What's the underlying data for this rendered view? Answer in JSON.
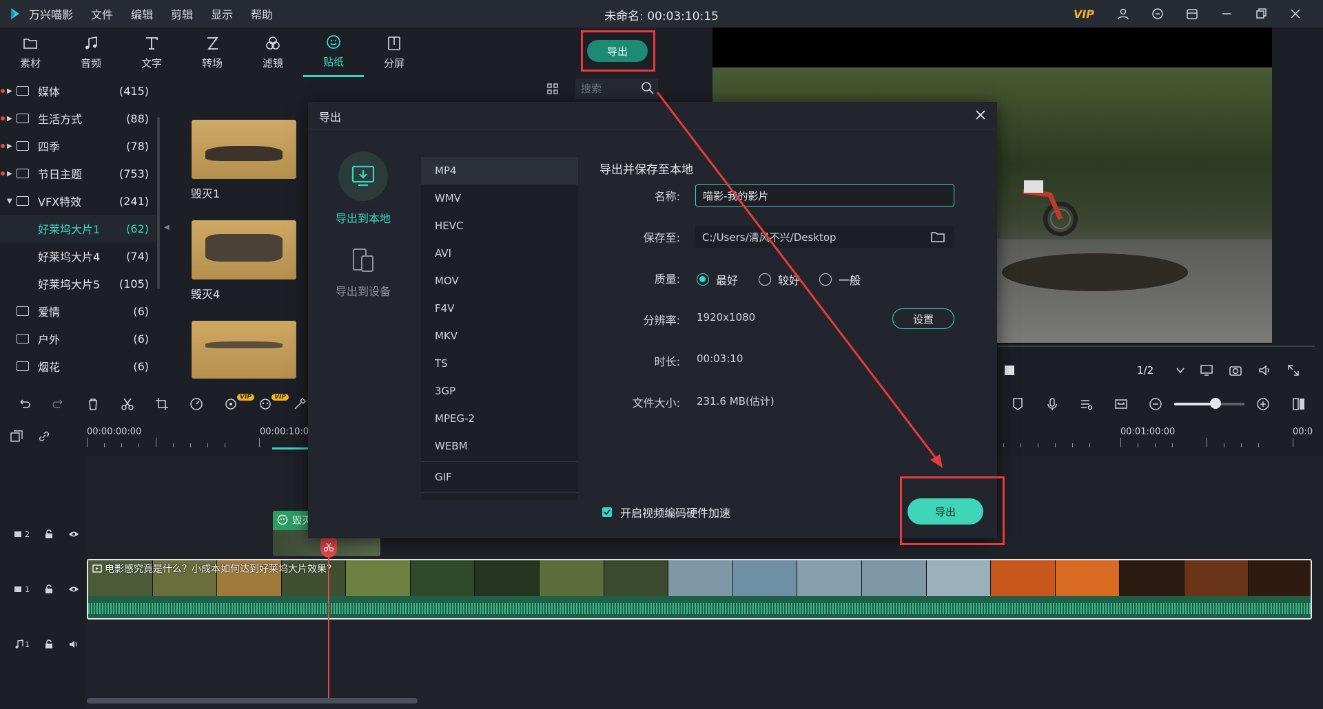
{
  "app": {
    "name": "万兴喵影",
    "window_title": "未命名: 00:03:10:15",
    "vip_label": "VIP"
  },
  "menu": [
    "文件",
    "编辑",
    "剪辑",
    "显示",
    "帮助"
  ],
  "toolbar": {
    "tabs": [
      "素材",
      "音频",
      "文字",
      "转场",
      "滤镜",
      "贴纸",
      "分屏"
    ],
    "active_tab": "贴纸",
    "export_label": "导出"
  },
  "categories": [
    {
      "name": "媒体",
      "count": "(415)",
      "dot": true,
      "arrow": "▶"
    },
    {
      "name": "生活方式",
      "count": "(88)",
      "dot": true,
      "arrow": "▶"
    },
    {
      "name": "四季",
      "count": "(78)",
      "dot": true,
      "arrow": "▶"
    },
    {
      "name": "节日主题",
      "count": "(753)",
      "dot": true,
      "arrow": "▶"
    },
    {
      "name": "VFX特效",
      "count": "(241)",
      "dot": false,
      "arrow": "▼"
    },
    {
      "name": "好莱坞大片1",
      "count": "(62)",
      "sub": true,
      "selected": true
    },
    {
      "name": "好莱坞大片4",
      "count": "(74)",
      "sub": true
    },
    {
      "name": "好莱坞大片5",
      "count": "(105)",
      "sub": true
    },
    {
      "name": "爱情",
      "count": "(6)"
    },
    {
      "name": "户外",
      "count": "(6)"
    },
    {
      "name": "烟花",
      "count": "(6)"
    }
  ],
  "search": {
    "placeholder": "搜索"
  },
  "stickers": [
    {
      "label": "毁灭1"
    },
    {
      "label": "毁灭4"
    }
  ],
  "preview": {
    "ratio": "1/2"
  },
  "ruler": {
    "t0": "00:00:00:00",
    "t1": "00:00:10:00",
    "t2": "00:01:00:00",
    "t3": "00:0"
  },
  "tracks": {
    "v2": "2",
    "v1": "1",
    "a1": "1"
  },
  "timeline": {
    "sticker_clip": "毁灭",
    "video_title": "电影感究竟是什么？小成本如何达到好莱坞大片效果？"
  },
  "dialog": {
    "title": "导出",
    "destinations": [
      "导出到本地",
      "导出到设备"
    ],
    "formats": [
      "MP4",
      "WMV",
      "HEVC",
      "AVI",
      "MOV",
      "F4V",
      "MKV",
      "TS",
      "3GP",
      "MPEG-2",
      "WEBM",
      "GIF"
    ],
    "selected_format": "MP4",
    "section_title": "导出并保存至本地",
    "name_label": "名称:",
    "name_value": "喵影-我的影片",
    "save_label": "保存至:",
    "save_path": "C:/Users/清风不兴/Desktop",
    "quality_label": "质量:",
    "quality_options": [
      "最好",
      "较好",
      "一般"
    ],
    "quality_selected": "最好",
    "resolution_label": "分辨率:",
    "resolution_value": "1920x1080",
    "settings_label": "设置",
    "duration_label": "时长:",
    "duration_value": "00:03:10",
    "filesize_label": "文件大小:",
    "filesize_value": "231.6 MB(估计)",
    "hw_accel_label": "开启视频编码硬件加速",
    "hw_accel_checked": true,
    "export_label": "导出"
  },
  "colors": {
    "accent": "#38d6c0",
    "annotation": "#e83a3a",
    "vip": "#f0b429"
  }
}
